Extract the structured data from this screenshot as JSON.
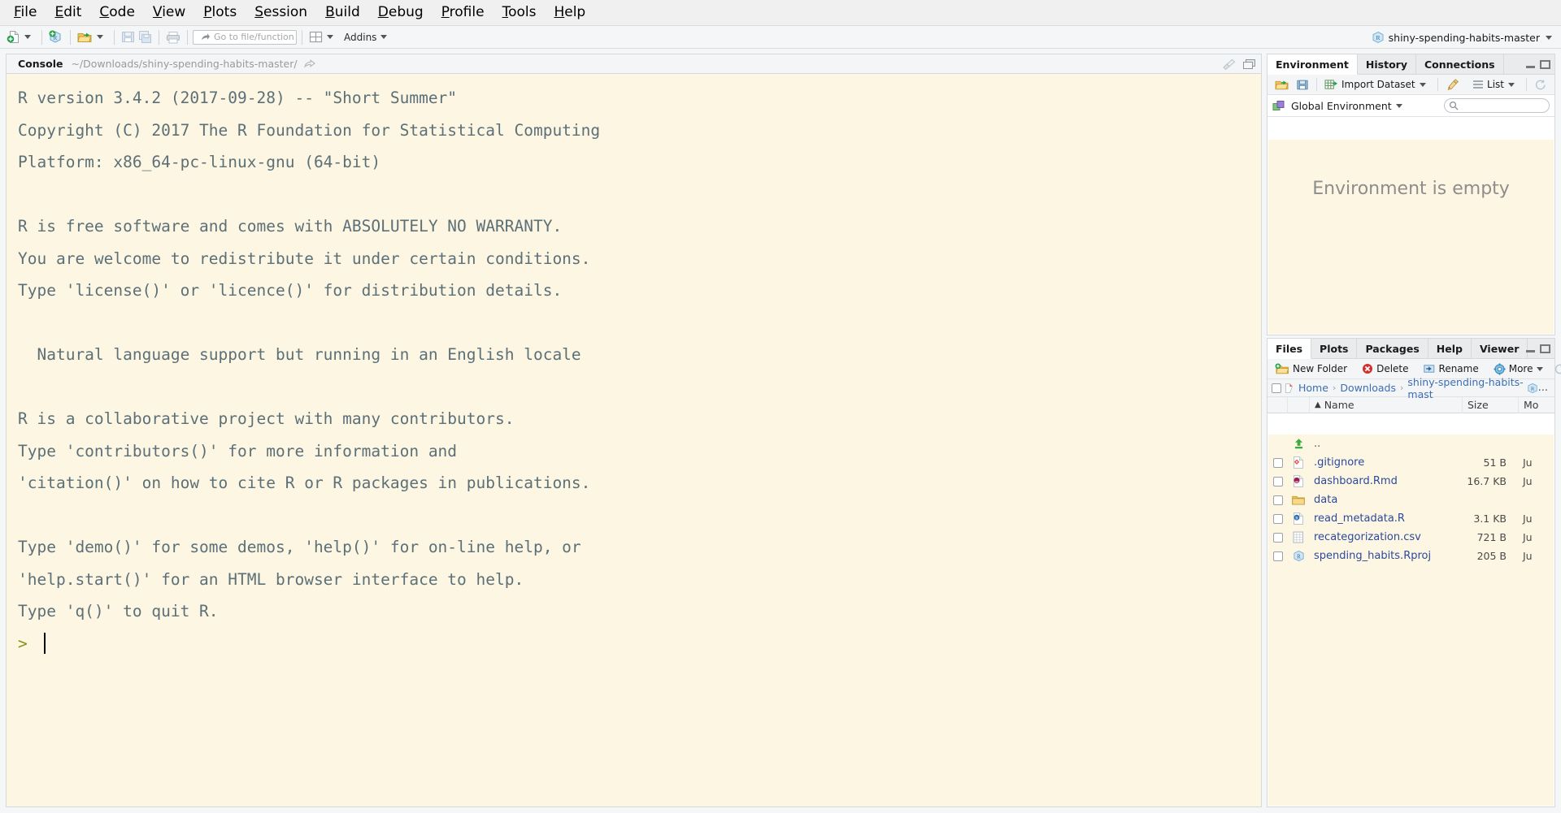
{
  "menubar": {
    "items": [
      {
        "label": "File",
        "mnemonic": "F"
      },
      {
        "label": "Edit",
        "mnemonic": "E"
      },
      {
        "label": "Code",
        "mnemonic": "C"
      },
      {
        "label": "View",
        "mnemonic": "V"
      },
      {
        "label": "Plots",
        "mnemonic": "P"
      },
      {
        "label": "Session",
        "mnemonic": "S"
      },
      {
        "label": "Build",
        "mnemonic": "B"
      },
      {
        "label": "Debug",
        "mnemonic": "D"
      },
      {
        "label": "Profile",
        "mnemonic": "P"
      },
      {
        "label": "Tools",
        "mnemonic": "T"
      },
      {
        "label": "Help",
        "mnemonic": "H"
      }
    ]
  },
  "toolbar": {
    "goto_placeholder": "Go to file/function",
    "addins_label": "Addins",
    "project_name": "shiny-spending-habits-master"
  },
  "console": {
    "tab_label": "Console",
    "path": "~/Downloads/shiny-spending-habits-master/",
    "output": "R version 3.4.2 (2017-09-28) -- \"Short Summer\"\nCopyright (C) 2017 The R Foundation for Statistical Computing\nPlatform: x86_64-pc-linux-gnu (64-bit)\n\nR is free software and comes with ABSOLUTELY NO WARRANTY.\nYou are welcome to redistribute it under certain conditions.\nType 'license()' or 'licence()' for distribution details.\n\n  Natural language support but running in an English locale\n\nR is a collaborative project with many contributors.\nType 'contributors()' for more information and\n'citation()' on how to cite R or R packages in publications.\n\nType 'demo()' for some demos, 'help()' for on-line help, or\n'help.start()' for an HTML browser interface to help.\nType 'q()' to quit R.\n",
    "prompt": ">",
    "input_value": ""
  },
  "environment_pane": {
    "tabs": [
      "Environment",
      "History",
      "Connections"
    ],
    "active_tab": "Environment",
    "toolbar": {
      "import_dataset": "Import Dataset",
      "view_mode": "List"
    },
    "scope": "Global Environment",
    "search_value": "",
    "empty_message": "Environment is empty"
  },
  "files_pane": {
    "tabs": [
      "Files",
      "Plots",
      "Packages",
      "Help",
      "Viewer"
    ],
    "active_tab": "Files",
    "toolbar": {
      "new_folder": "New Folder",
      "delete": "Delete",
      "rename": "Rename",
      "more": "More"
    },
    "breadcrumb": [
      "Home",
      "Downloads",
      "shiny-spending-habits-mast"
    ],
    "breadcrumb_overflow": "...",
    "columns": {
      "name": "Name",
      "size": "Size",
      "modified": "Mo"
    },
    "sort_indicator": "▲",
    "rows": [
      {
        "name": "..",
        "icon": "up-arrow-icon",
        "size": "",
        "modified": "",
        "link": false
      },
      {
        "name": ".gitignore",
        "icon": "git-file-icon",
        "size": "51 B",
        "modified": "Ju",
        "link": true
      },
      {
        "name": "dashboard.Rmd",
        "icon": "rmarkdown-file-icon",
        "size": "16.7 KB",
        "modified": "Ju",
        "link": true
      },
      {
        "name": "data",
        "icon": "folder-icon",
        "size": "",
        "modified": "",
        "link": true
      },
      {
        "name": "read_metadata.R",
        "icon": "r-script-icon",
        "size": "3.1 KB",
        "modified": "Ju",
        "link": true
      },
      {
        "name": "recategorization.csv",
        "icon": "csv-file-icon",
        "size": "721 B",
        "modified": "Ju",
        "link": true
      },
      {
        "name": "spending_habits.Rproj",
        "icon": "rproject-icon",
        "size": "205 B",
        "modified": "Ju",
        "link": true
      }
    ]
  },
  "colors": {
    "console_bg": "#fdf6e3",
    "console_text": "#5c7078",
    "prompt": "#8a8f14",
    "link": "#2b4a9b",
    "chrome_bg": "#f0f0f0"
  }
}
